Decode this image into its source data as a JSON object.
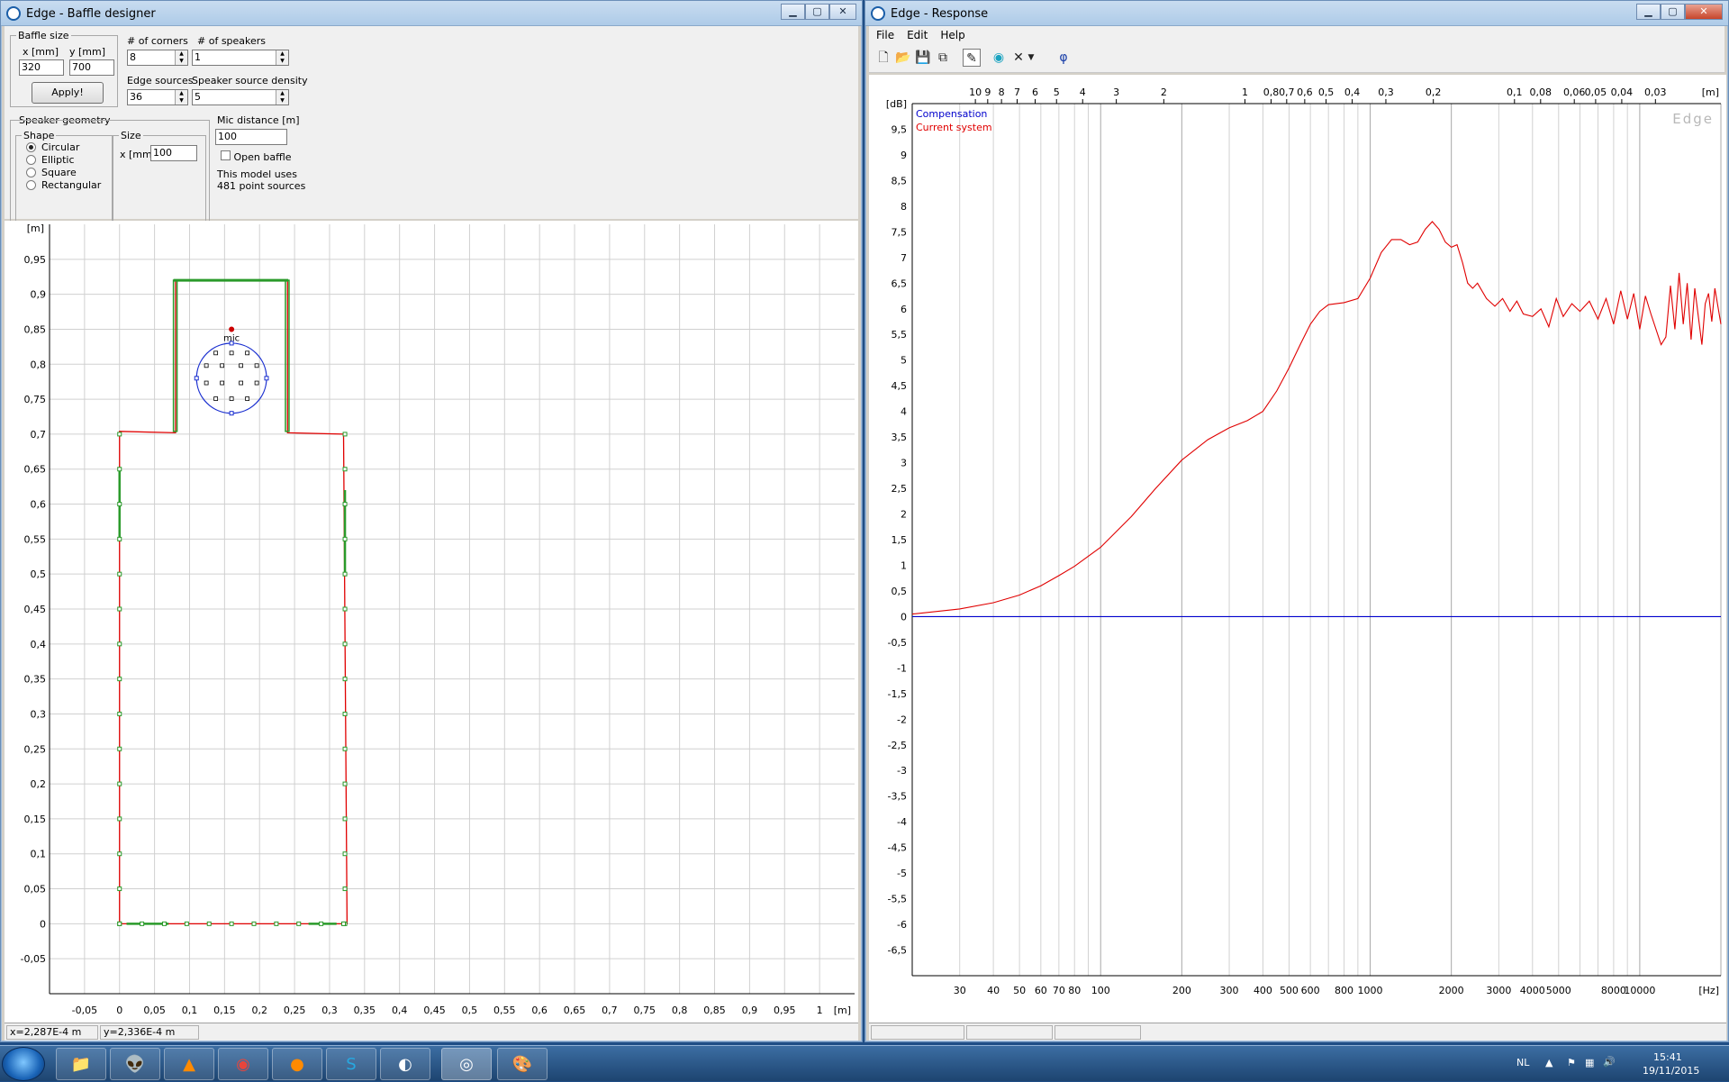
{
  "baffle_window": {
    "title": "Edge - Baffle designer",
    "baffle_size_legend": "Baffle size",
    "x_label": "x [mm]",
    "y_label": "y [mm]",
    "x_value": "320",
    "y_value": "700",
    "apply_label": "Apply!",
    "corners_label": "# of corners",
    "corners_value": "8",
    "speakers_label": "# of speakers",
    "speakers_value": "1",
    "edge_sources_label": "Edge sources",
    "edge_sources_value": "36",
    "density_label": "Speaker source density",
    "density_value": "5",
    "geometry_legend": "Speaker geometry",
    "shape_legend": "Shape",
    "shapes": [
      "Circular",
      "Elliptic",
      "Square",
      "Rectangular"
    ],
    "shape_selected": "Circular",
    "size_legend": "Size",
    "size_x_label": "x [mm]",
    "size_x_value": "100",
    "mic_distance_label": "Mic distance [m]",
    "mic_distance_value": "100",
    "open_baffle_label": "Open baffle",
    "model_info_1": "This model uses",
    "model_info_2": "481 point sources",
    "status_x": "x=2,287E-4 m",
    "status_y": "y=2,336E-4 m",
    "plot": {
      "unit_label": "[m]",
      "mic_label": "mic",
      "x_ticks": [
        "-0,05",
        "0",
        "0,05",
        "0,1",
        "0,15",
        "0,2",
        "0,25",
        "0,3",
        "0,35",
        "0,4",
        "0,45",
        "0,5",
        "0,55",
        "0,6",
        "0,65",
        "0,7",
        "0,75",
        "0,8",
        "0,85",
        "0,9",
        "0,95",
        "1"
      ],
      "y_ticks": [
        "0,95",
        "0,9",
        "0,85",
        "0,8",
        "0,75",
        "0,7",
        "0,65",
        "0,6",
        "0,55",
        "0,5",
        "0,45",
        "0,4",
        "0,35",
        "0,3",
        "0,25",
        "0,2",
        "0,15",
        "0,1",
        "0,05",
        "0",
        "-0,05"
      ]
    }
  },
  "response_window": {
    "title": "Edge - Response",
    "menu": [
      "File",
      "Edit",
      "Help"
    ],
    "toolbar_icons": [
      "new-file-icon",
      "open-folder-icon",
      "save-icon",
      "copy-icon",
      "pencil-icon",
      "speaker-icon",
      "delete-icon",
      "dropdown-icon",
      "phi-icon"
    ],
    "phi_glyph": "φ",
    "watermark": "Edge",
    "legend": [
      {
        "name": "Compensation",
        "color": "#0000cc"
      },
      {
        "name": "Current system",
        "color": "#e00000"
      }
    ],
    "chart_data": {
      "type": "line",
      "xlabel_unit": "[Hz]",
      "top_axis_unit": "[m]",
      "ylabel": "[dB]",
      "x_scale": "log",
      "xlim": [
        20,
        20000
      ],
      "ylim": [
        -7,
        10
      ],
      "x_ticks": [
        "30",
        "40",
        "50",
        "60",
        "70",
        "80",
        "100",
        "200",
        "300",
        "400",
        "500",
        "600",
        "800",
        "1000",
        "2000",
        "3000",
        "4000",
        "5000",
        "8000",
        "10000"
      ],
      "top_ticks": [
        "10",
        "9",
        "8",
        "7",
        "6",
        "5",
        "4",
        "3",
        "2",
        "1",
        "0,8",
        "0,7",
        "0,6",
        "0,5",
        "0,4",
        "0,3",
        "0,2",
        "0,1",
        "0,08",
        "0,06",
        "0,05",
        "0,04",
        "0,03"
      ],
      "y_ticks": [
        "9,5",
        "9",
        "8,5",
        "8",
        "7,5",
        "7",
        "6,5",
        "6",
        "5,5",
        "5",
        "4,5",
        "4",
        "3,5",
        "3",
        "2,5",
        "2",
        "1,5",
        "1",
        "0,5",
        "0",
        "-0,5",
        "-1",
        "-1,5",
        "-2",
        "-2,5",
        "-3",
        "-3,5",
        "-4",
        "-4,5",
        "-5",
        "-5,5",
        "-6",
        "-6,5"
      ],
      "series": [
        {
          "name": "Compensation",
          "color": "#0000cc",
          "points": [
            [
              20,
              0
            ],
            [
              20000,
              0
            ]
          ]
        },
        {
          "name": "Current system",
          "color": "#e00000",
          "points": [
            [
              20,
              0.05
            ],
            [
              30,
              0.15
            ],
            [
              40,
              0.27
            ],
            [
              50,
              0.42
            ],
            [
              60,
              0.6
            ],
            [
              70,
              0.8
            ],
            [
              80,
              0.98
            ],
            [
              100,
              1.35
            ],
            [
              130,
              1.95
            ],
            [
              160,
              2.5
            ],
            [
              200,
              3.05
            ],
            [
              250,
              3.45
            ],
            [
              300,
              3.68
            ],
            [
              350,
              3.82
            ],
            [
              400,
              4.0
            ],
            [
              450,
              4.4
            ],
            [
              500,
              4.85
            ],
            [
              550,
              5.3
            ],
            [
              600,
              5.7
            ],
            [
              650,
              5.95
            ],
            [
              700,
              6.08
            ],
            [
              800,
              6.12
            ],
            [
              900,
              6.2
            ],
            [
              1000,
              6.6
            ],
            [
              1100,
              7.1
            ],
            [
              1200,
              7.35
            ],
            [
              1300,
              7.35
            ],
            [
              1400,
              7.25
            ],
            [
              1500,
              7.3
            ],
            [
              1600,
              7.55
            ],
            [
              1700,
              7.7
            ],
            [
              1800,
              7.55
            ],
            [
              1900,
              7.3
            ],
            [
              2000,
              7.2
            ],
            [
              2100,
              7.25
            ],
            [
              2200,
              6.9
            ],
            [
              2300,
              6.5
            ],
            [
              2400,
              6.4
            ],
            [
              2500,
              6.5
            ],
            [
              2700,
              6.2
            ],
            [
              2900,
              6.05
            ],
            [
              3100,
              6.2
            ],
            [
              3300,
              5.95
            ],
            [
              3500,
              6.15
            ],
            [
              3700,
              5.9
            ],
            [
              4000,
              5.85
            ],
            [
              4300,
              6.0
            ],
            [
              4600,
              5.65
            ],
            [
              4900,
              6.2
            ],
            [
              5200,
              5.85
            ],
            [
              5600,
              6.1
            ],
            [
              6000,
              5.95
            ],
            [
              6500,
              6.15
            ],
            [
              7000,
              5.8
            ],
            [
              7500,
              6.2
            ],
            [
              8000,
              5.7
            ],
            [
              8500,
              6.35
            ],
            [
              9000,
              5.8
            ],
            [
              9500,
              6.3
            ],
            [
              10000,
              5.6
            ],
            [
              10500,
              6.25
            ],
            [
              11000,
              5.9
            ],
            [
              12000,
              5.3
            ],
            [
              12500,
              5.45
            ],
            [
              13000,
              6.45
            ],
            [
              13500,
              5.6
            ],
            [
              14000,
              6.7
            ],
            [
              14500,
              5.7
            ],
            [
              15000,
              6.5
            ],
            [
              15500,
              5.4
            ],
            [
              16000,
              6.4
            ],
            [
              17000,
              5.3
            ],
            [
              17500,
              6.1
            ],
            [
              18000,
              6.3
            ],
            [
              18500,
              5.75
            ],
            [
              19000,
              6.4
            ],
            [
              20000,
              5.7
            ]
          ]
        }
      ]
    }
  },
  "taskbar": {
    "apps": [
      "explorer-icon",
      "alien-app-icon",
      "vlc-icon",
      "chrome-icon",
      "firefox-icon",
      "skype-icon",
      "speaker-app-icon",
      "edge-app-icon",
      "paint-icon"
    ],
    "language": "NL",
    "time": "15:41",
    "date": "19/11/2015"
  }
}
